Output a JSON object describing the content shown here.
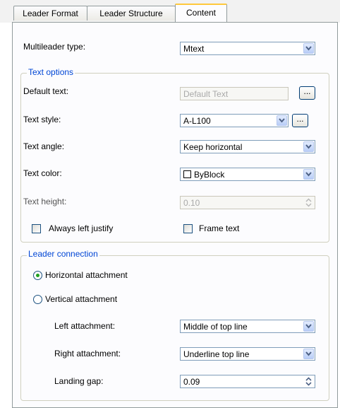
{
  "tabs": [
    {
      "label": "Leader Format"
    },
    {
      "label": "Leader Structure"
    },
    {
      "label": "Content"
    }
  ],
  "multileader_type": {
    "label": "Multileader type:",
    "value": "Mtext"
  },
  "text_options": {
    "title": "Text options",
    "default_text": {
      "label": "Default text:",
      "value": "Default Text",
      "button": "..."
    },
    "text_style": {
      "label": "Text style:",
      "value": "A-L100",
      "button": "..."
    },
    "text_angle": {
      "label": "Text angle:",
      "value": "Keep horizontal"
    },
    "text_color": {
      "label": "Text color:",
      "value": "ByBlock"
    },
    "text_height": {
      "label": "Text height:",
      "value": "0.10"
    },
    "always_left_justify": {
      "label": "Always left justify",
      "checked": false
    },
    "frame_text": {
      "label": "Frame text",
      "checked": false
    }
  },
  "leader_connection": {
    "title": "Leader connection",
    "horizontal": {
      "label": "Horizontal attachment",
      "selected": true
    },
    "vertical": {
      "label": "Vertical attachment",
      "selected": false
    },
    "left_attachment": {
      "label": "Left attachment:",
      "value": "Middle of top line"
    },
    "right_attachment": {
      "label": "Right attachment:",
      "value": "Underline top line"
    },
    "landing_gap": {
      "label": "Landing gap:",
      "value": "0.09"
    }
  },
  "colors": {
    "accent": "#0046d5",
    "tab_highlight": "#ffc83c",
    "border": "#919b9c"
  }
}
